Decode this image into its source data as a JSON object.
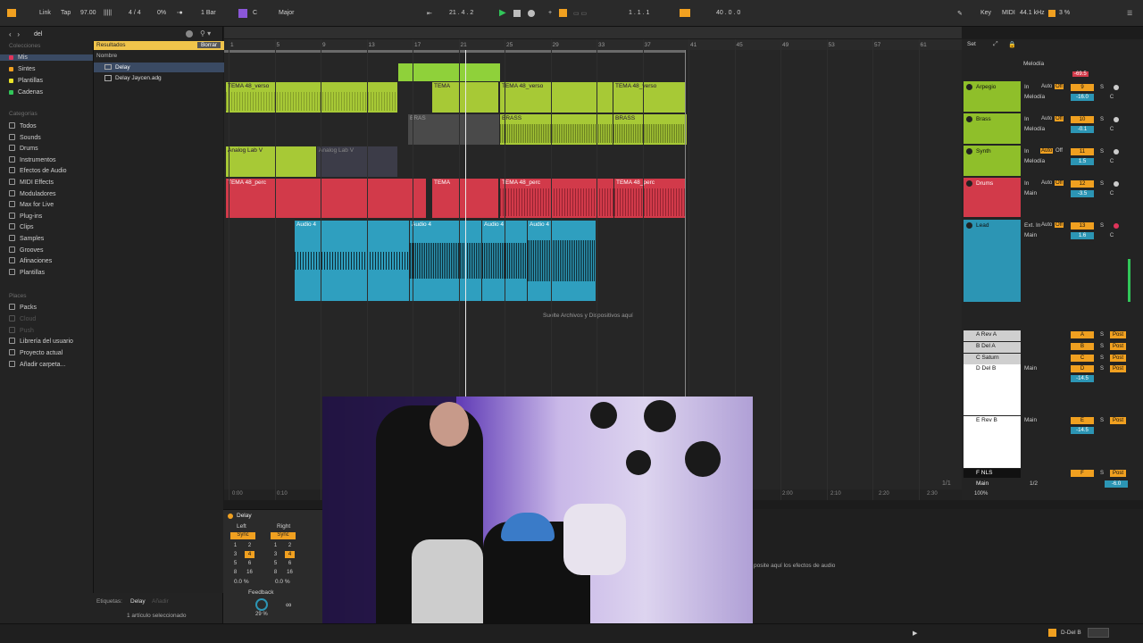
{
  "topbar": {
    "link": "Link",
    "tap": "Tap",
    "tempo": "97.00",
    "time_sig": "4 / 4",
    "cpu_percent": "0%",
    "quant": "1 Bar",
    "key_root": "C",
    "key_scale": "Major",
    "position": "21 .  4 .  2",
    "loop_start": "1 .  1 .  1",
    "loop_length": "40 .  0 .  0",
    "key": "Key",
    "midi": "MIDI",
    "sample_rate": "44.1 kHz",
    "cpu_load": "3 %"
  },
  "browser": {
    "search_value": "del",
    "collections_title": "Colecciones",
    "collections": [
      {
        "label": "Mis",
        "color": "#e0345a"
      },
      {
        "label": "Sintes",
        "color": "#f0a020"
      },
      {
        "label": "Plantillas",
        "color": "#e9e32a"
      },
      {
        "label": "Cadenas",
        "color": "#31c659"
      }
    ],
    "categories_title": "Categorías",
    "categories": [
      "Todos",
      "Sounds",
      "Drums",
      "Instrumentos",
      "Efectos de Audio",
      "MIDI Effects",
      "Moduladores",
      "Max for Live",
      "Plug-ins",
      "Clips",
      "Samples",
      "Grooves",
      "Afinaciones",
      "Plantillas"
    ],
    "places_title": "Places",
    "places": [
      "Packs",
      "Cloud",
      "Push",
      "Librería del usuario",
      "Proyecto actual",
      "Añadir carpeta..."
    ],
    "results_label": "Resultados",
    "clear_button": "Borrar",
    "name_header": "Nombre",
    "results": [
      "Delay",
      "Delay Jaycen.adg"
    ],
    "tags_label": "Etiquetas:",
    "tag_value": "Delay",
    "tag_add": "Añadir",
    "selection_status": "1 artículo seleccionado"
  },
  "arrangement": {
    "ruler": [
      "1",
      "5",
      "9",
      "13",
      "17",
      "21",
      "25",
      "29",
      "33",
      "37",
      "41",
      "45",
      "49",
      "53",
      "57",
      "61"
    ],
    "time_ruler": [
      "0:00",
      "0:10",
      "2:00",
      "2:10",
      "2:20",
      "2:30"
    ],
    "drop_hint": "Suelte Archivos y Dispositivos aquí",
    "clips": {
      "verse1": "TEMA 48_verso",
      "verse2": "TEMA 48_verso",
      "verse3": "TEMA 48_verso",
      "tema_short": "TEMA",
      "brass": "BRASS",
      "brass2": "BRASS",
      "bras_short": "BRAS",
      "analog1": "Analog Lab V",
      "analog2": "Analog Lab V",
      "perc1": "TEMA 48_perc",
      "perc2": "TEMA 48_perc",
      "perc3": "TEMA 48_perc",
      "audio": "Audio 4"
    }
  },
  "mixer": {
    "set_label": "Set",
    "tracks": [
      {
        "name": "Arpegio",
        "color": "#8fbf2a",
        "num": "9",
        "route": "Melodía",
        "vol": "-16.0"
      },
      {
        "name": "Brass",
        "color": "#8fbf2a",
        "num": "10",
        "route": "Melodía",
        "vol": "-0.1"
      },
      {
        "name": "Synth",
        "color": "#8fbf2a",
        "num": "11",
        "route": "Melodía",
        "vol": "1.5"
      },
      {
        "name": "Drums",
        "color": "#d23a4a",
        "num": "12",
        "route": "Main",
        "vol": "-3.5"
      },
      {
        "name": "Lead",
        "color": "#2c95b4",
        "num": "13",
        "route": "Main",
        "vol": "1.6"
      }
    ],
    "top_route": "Melodía",
    "top_vol": "-69.5",
    "input_in": "In",
    "input_auto": "Auto",
    "input_off": "Off",
    "ext_in": "Ext. In",
    "returns": [
      {
        "name": "A Rev A",
        "letter": "A"
      },
      {
        "name": "B Del A",
        "letter": "B"
      },
      {
        "name": "C Saturn",
        "letter": "C"
      },
      {
        "name": "D Del B",
        "letter": "D",
        "route": "Main",
        "vol": "-14.5"
      },
      {
        "name": "E Rev B",
        "letter": "E",
        "route": "Main",
        "vol": "-14.5"
      },
      {
        "name": "F NLS",
        "letter": "F"
      }
    ],
    "post": "Post",
    "main_label": "Main",
    "main_sel": "1/2",
    "main_vol": "-6.0",
    "main_pct": "100%",
    "page": "1/1"
  },
  "device": {
    "name": "Delay",
    "left": "Left",
    "right": "Right",
    "sync": "Sync",
    "pad_left": [
      "1",
      "2",
      "3",
      "4",
      "5",
      "6",
      "8",
      "16"
    ],
    "pad_right": [
      "1",
      "2",
      "3",
      "4",
      "5",
      "6",
      "8",
      "16"
    ],
    "offset_left": "0.0 %",
    "offset_right": "0.0 %",
    "feedback_label": "Feedback",
    "feedback_value": "29 %",
    "drop_effects": "posite aquí los efectos de audio"
  },
  "status": {
    "track": "D-Del B"
  },
  "colors": {
    "green": "#8fbf2a",
    "red": "#d23a4a",
    "blue": "#2c95b4",
    "orange": "#f0a020"
  }
}
